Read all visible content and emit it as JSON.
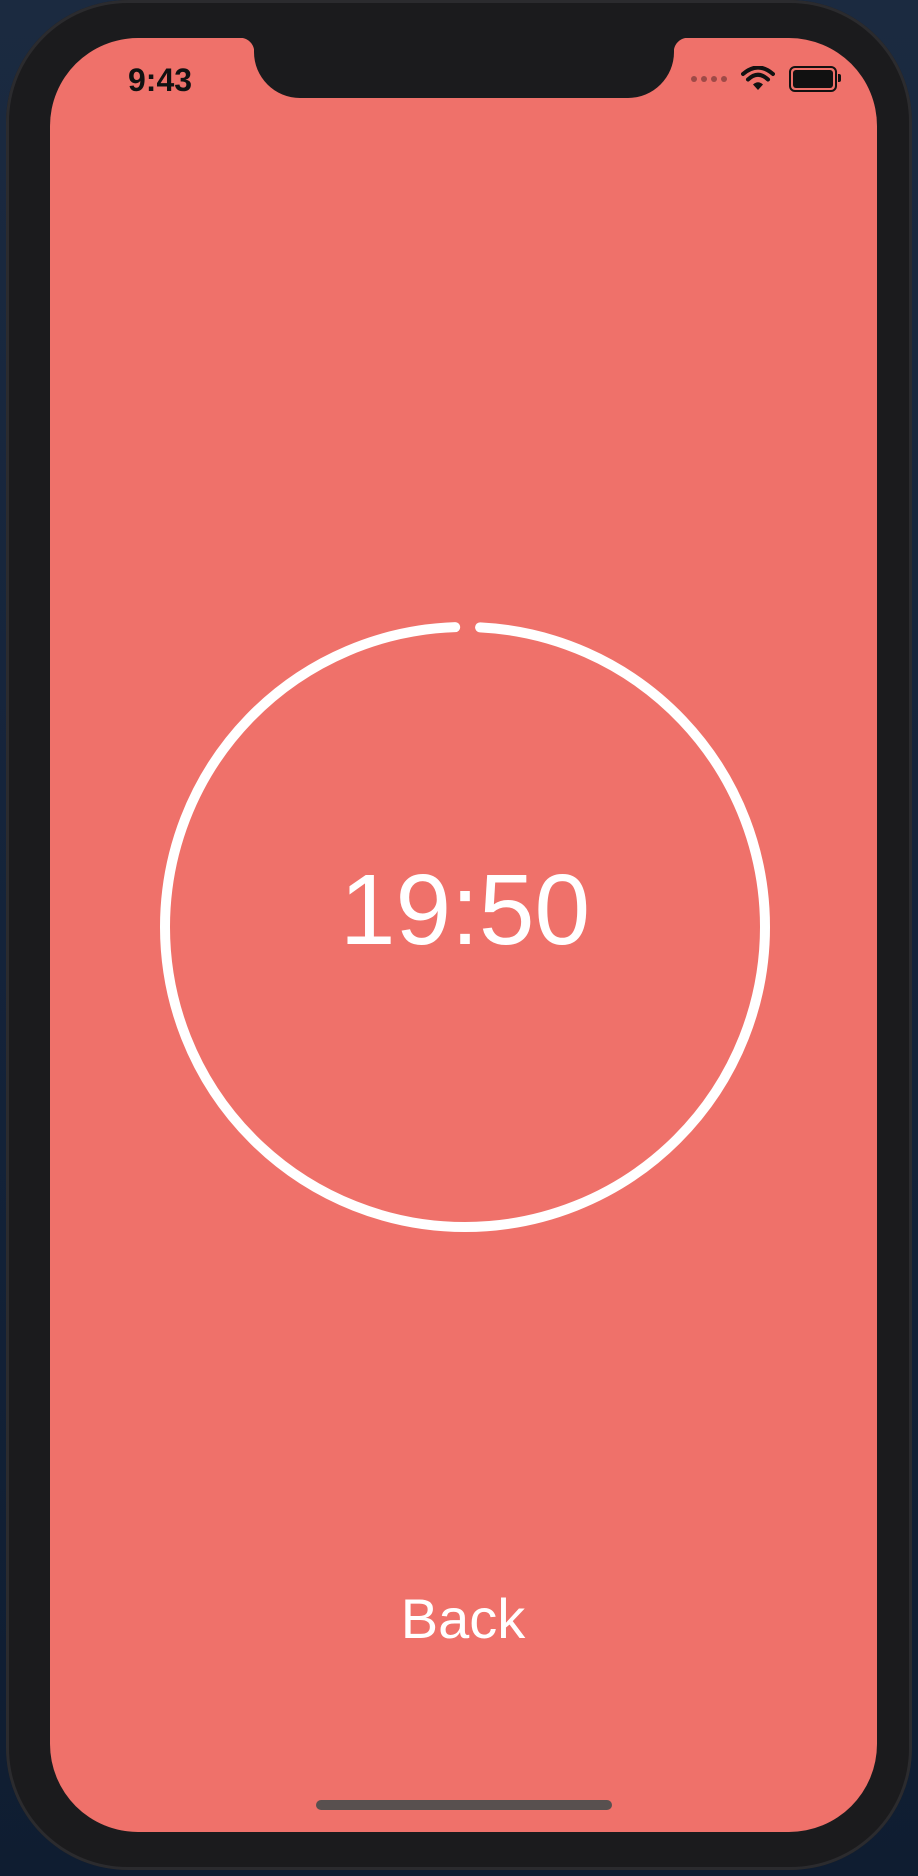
{
  "status_bar": {
    "time": "9:43",
    "wifi_icon": "wifi-icon",
    "battery_icon": "battery-icon",
    "signal_icon": "signal-dots-icon"
  },
  "timer": {
    "display": "19:50",
    "progress_remaining": 0.992
  },
  "back_button": {
    "label": "Back"
  },
  "colors": {
    "background": "#ef716a",
    "foreground": "#ffffff",
    "device": "#1b1b1d"
  }
}
